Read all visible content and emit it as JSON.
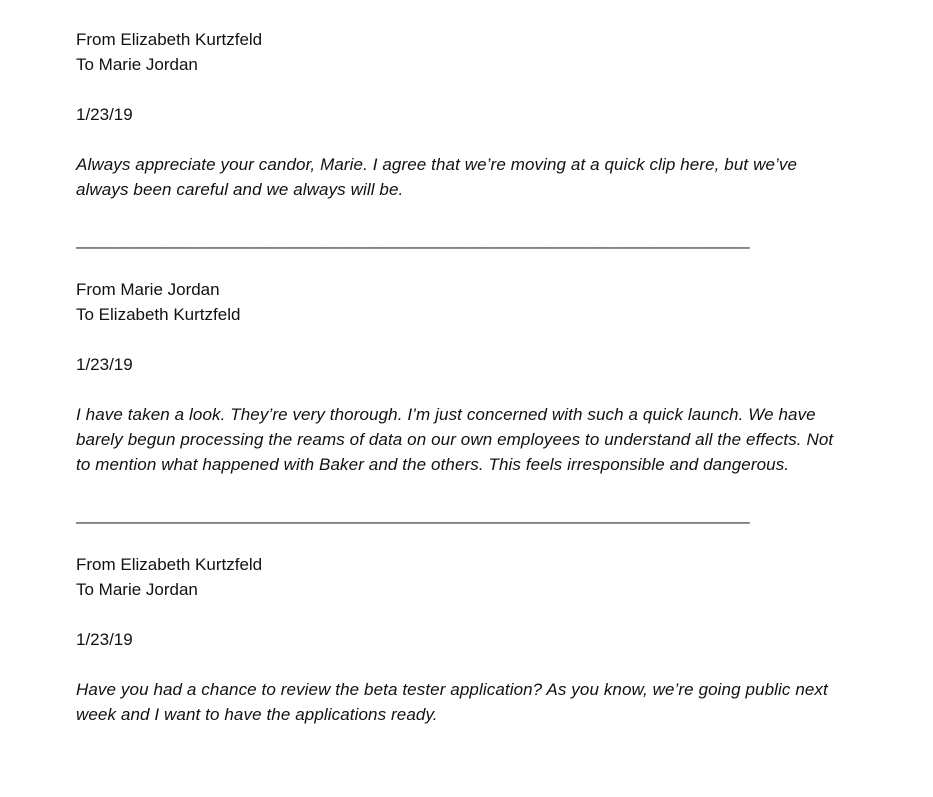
{
  "messages": [
    {
      "from": "From Elizabeth Kurtzfeld",
      "to": "To Marie Jordan",
      "date": "1/23/19",
      "body": "Always appreciate your candor, Marie. I agree that we’re moving at a quick clip here, but we’ve always been careful and we always will be."
    },
    {
      "from": "From Marie Jordan",
      "to": "To Elizabeth Kurtzfeld",
      "date": "1/23/19",
      "body": "I have taken a look. They’re very thorough. I’m just concerned with such a quick launch. We have barely begun processing the reams of data on our own employees to understand all the effects. Not to mention what happened with Baker and the others. This feels irresponsible and dangerous."
    },
    {
      "from": "From Elizabeth Kurtzfeld",
      "to": "To Marie Jordan",
      "date": "1/23/19",
      "body": "Have you had a chance to review the beta tester application? As you know, we’re going public next week and I want to have the applications ready."
    }
  ],
  "divider": "____________________________________________________________________________"
}
